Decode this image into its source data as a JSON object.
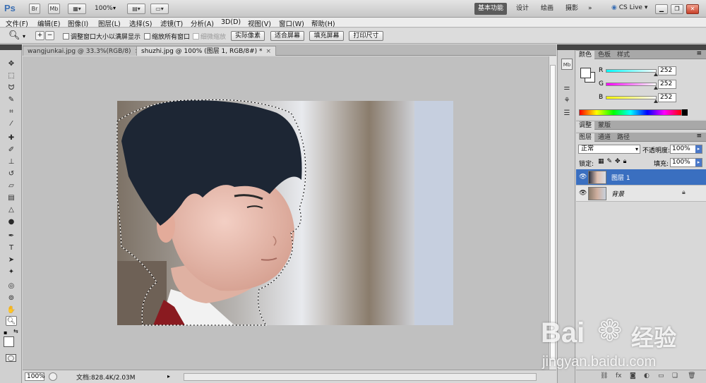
{
  "app": {
    "logo": "Ps",
    "launch_buttons": [
      "Br",
      "Mb"
    ],
    "zoom_display": "100%",
    "workspaces": [
      "基本功能",
      "设计",
      "绘画",
      "摄影",
      "»"
    ],
    "active_workspace": "基本功能",
    "cs_live": "CS Live"
  },
  "menu": [
    "文件(F)",
    "编辑(E)",
    "图像(I)",
    "图层(L)",
    "选择(S)",
    "滤镜(T)",
    "分析(A)",
    "3D(D)",
    "视图(V)",
    "窗口(W)",
    "帮助(H)"
  ],
  "options": {
    "checkbox_resize_windows": "调整窗口大小以满屏显示",
    "checkbox_zoom_all": "缩放所有窗口",
    "checkbox_scrubby": "细微缩放",
    "btn_actual_pixels": "实际像素",
    "btn_fit_screen": "适合屏幕",
    "btn_fill_screen": "填充屏幕",
    "btn_print_size": "打印尺寸"
  },
  "documents": {
    "tabs": [
      {
        "label": "wangjunkai.jpg @ 33.3%(RGB/8)",
        "close": "×"
      },
      {
        "label": "shuzhi.jpg @ 100% (图层 1, RGB/8#) *",
        "close": "×"
      }
    ],
    "active_index": 1
  },
  "statusbar": {
    "zoom": "100%",
    "doc_info": "文档:828.4K/2.03M"
  },
  "panels": {
    "color": {
      "tabs": [
        "颜色",
        "色板",
        "样式"
      ],
      "rows": [
        {
          "label": "R",
          "value": "252"
        },
        {
          "label": "G",
          "value": "252"
        },
        {
          "label": "B",
          "value": "252"
        }
      ]
    },
    "adjust": {
      "tabs": [
        "调整",
        "蒙版"
      ]
    },
    "layers": {
      "tabs": [
        "图层",
        "通道",
        "路径"
      ],
      "blend_mode": "正常",
      "opacity_label": "不透明度:",
      "opacity_value": "100%",
      "lock_label": "锁定:",
      "fill_label": "填充:",
      "fill_value": "100%",
      "items": [
        {
          "name": "图层 1",
          "selected": true
        },
        {
          "name": "背景",
          "selected": false,
          "locked": true
        }
      ]
    }
  },
  "watermark": {
    "brand": "Bai",
    "brand_suffix": "经验",
    "url": "jingyan.baidu.com"
  },
  "colors": {
    "accent": "#3a6fc0",
    "canvas_bg": "#c0c0c0"
  }
}
